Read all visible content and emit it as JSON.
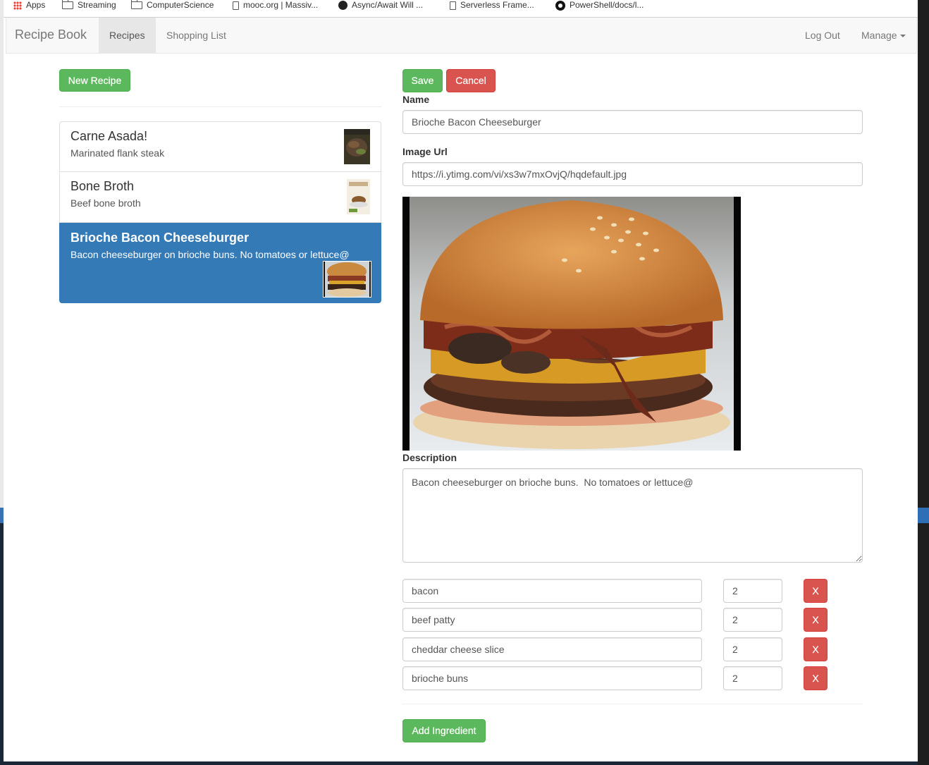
{
  "bookmarks": [
    {
      "label": "Apps",
      "icon": "apps-icon"
    },
    {
      "label": "Streaming",
      "icon": "folder-icon"
    },
    {
      "label": "ComputerScience",
      "icon": "folder-icon"
    },
    {
      "label": "mooc.org | Massiv...",
      "icon": "page-icon"
    },
    {
      "label": "Async/Await Will ...",
      "icon": "site-icon"
    },
    {
      "label": "Serverless Frame...",
      "icon": "page-icon"
    },
    {
      "label": "PowerShell/docs/l...",
      "icon": "github-icon"
    }
  ],
  "navbar": {
    "brand": "Recipe Book",
    "recipes": "Recipes",
    "shopping_list": "Shopping List",
    "logout": "Log Out",
    "manage": "Manage"
  },
  "left": {
    "new_recipe": "New Recipe",
    "recipes": [
      {
        "name": "Carne Asada!",
        "description": "Marinated flank steak"
      },
      {
        "name": "Bone Broth",
        "description": "Beef bone broth"
      },
      {
        "name": "Brioche Bacon Cheeseburger",
        "description": "Bacon cheeseburger on brioche buns. No tomatoes or lettuce@"
      }
    ]
  },
  "editor": {
    "save": "Save",
    "cancel": "Cancel",
    "name_label": "Name",
    "name_value": "Brioche Bacon Cheeseburger",
    "image_url_label": "Image Url",
    "image_url_value": "https://i.ytimg.com/vi/xs3w7mxOvjQ/hqdefault.jpg",
    "description_label": "Description",
    "description_value": "Bacon cheeseburger on brioche buns.  No tomatoes or lettuce@",
    "ingredients": [
      {
        "name": "bacon",
        "amount": "2",
        "remove": "X"
      },
      {
        "name": "beef patty",
        "amount": "2",
        "remove": "X"
      },
      {
        "name": "cheddar cheese slice",
        "amount": "2",
        "remove": "X"
      },
      {
        "name": "brioche buns",
        "amount": "2",
        "remove": "X"
      }
    ],
    "add_ingredient": "Add Ingredient"
  },
  "colors": {
    "primary": "#337ab7",
    "success": "#5cb85c",
    "danger": "#d9534f"
  }
}
